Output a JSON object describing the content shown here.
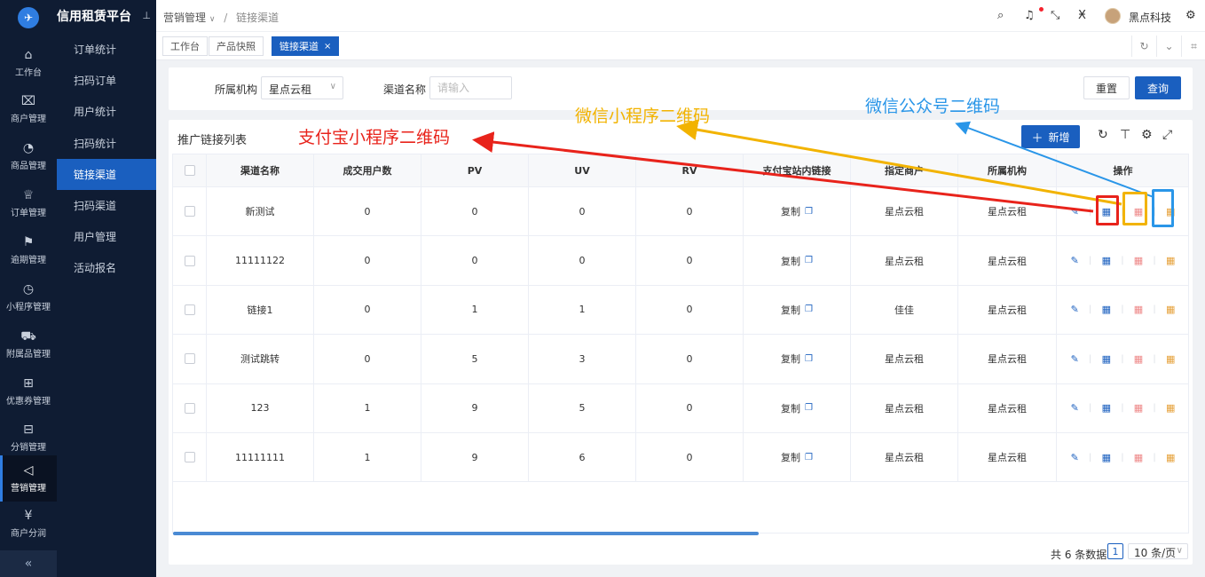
{
  "app": {
    "brand": "信用租赁平台",
    "pin_icon": "pin-icon"
  },
  "rail": {
    "items": [
      {
        "label": "工作台",
        "icon": "⌂"
      },
      {
        "label": "商户管理",
        "icon": "⌧"
      },
      {
        "label": "商品管理",
        "icon": "◔"
      },
      {
        "label": "订单管理",
        "icon": "♕"
      },
      {
        "label": "逾期管理",
        "icon": "⚑"
      },
      {
        "label": "小程序管理",
        "icon": "◷"
      },
      {
        "label": "附属品管理",
        "icon": "⛟"
      },
      {
        "label": "优惠券管理",
        "icon": "⊞"
      },
      {
        "label": "分销管理",
        "icon": "⊟"
      },
      {
        "label": "营销管理",
        "icon": "◁"
      },
      {
        "label": "商户分润",
        "icon": "¥"
      }
    ],
    "active_index": 9,
    "collapse_icon": "«"
  },
  "sidebar": {
    "items": [
      "订单统计",
      "扫码订单",
      "用户统计",
      "扫码统计",
      "链接渠道",
      "扫码渠道",
      "用户管理",
      "活动报名"
    ],
    "active_index": 4
  },
  "header": {
    "breadcrumb_parent": "营销管理",
    "breadcrumb_current": "链接渠道",
    "user_name": "黑点科技"
  },
  "tabs": [
    {
      "label": "工作台"
    },
    {
      "label": "产品快照"
    },
    {
      "label": "链接渠道",
      "active": true
    }
  ],
  "filter": {
    "org_label": "所属机构",
    "org_value": "星点云租",
    "channel_label": "渠道名称",
    "channel_placeholder": "请输入",
    "reset_label": "重置",
    "query_label": "查询"
  },
  "list": {
    "title": "推广链接列表",
    "new_label": "新增",
    "columns": [
      "渠道名称",
      "成交用户数",
      "PV",
      "UV",
      "RV",
      "支付宝站内链接",
      "指定商户",
      "所属机构",
      "操作"
    ],
    "copy_label": "复制",
    "rows": [
      {
        "name": "新测试",
        "users": "0",
        "pv": "0",
        "uv": "0",
        "rv": "0",
        "merchant": "星点云租",
        "org": "星点云租"
      },
      {
        "name": "11111122",
        "users": "0",
        "pv": "0",
        "uv": "0",
        "rv": "0",
        "merchant": "星点云租",
        "org": "星点云租"
      },
      {
        "name": "链接1",
        "users": "0",
        "pv": "1",
        "uv": "1",
        "rv": "0",
        "merchant": "佳佳",
        "org": "星点云租"
      },
      {
        "name": "测试跳转",
        "users": "0",
        "pv": "5",
        "uv": "3",
        "rv": "0",
        "merchant": "星点云租",
        "org": "星点云租"
      },
      {
        "name": "123",
        "users": "1",
        "pv": "9",
        "uv": "5",
        "rv": "0",
        "merchant": "星点云租",
        "org": "星点云租"
      },
      {
        "name": "11111111",
        "users": "1",
        "pv": "9",
        "uv": "6",
        "rv": "0",
        "merchant": "星点云租",
        "org": "星点云租"
      }
    ]
  },
  "pagination": {
    "total_text": "共 6 条数据",
    "current_page": "1",
    "page_size": "10 条/页"
  },
  "annotations": {
    "alipay": {
      "text": "支付宝小程序二维码",
      "color": "#e8231b"
    },
    "wechat_mini": {
      "text": "微信小程序二维码",
      "color": "#f2b300"
    },
    "wechat_official": {
      "text": "微信公众号二维码",
      "color": "#2a96e8"
    }
  },
  "colors": {
    "accent": "#1a5fbf",
    "rail_bg": "#0f1c33"
  }
}
